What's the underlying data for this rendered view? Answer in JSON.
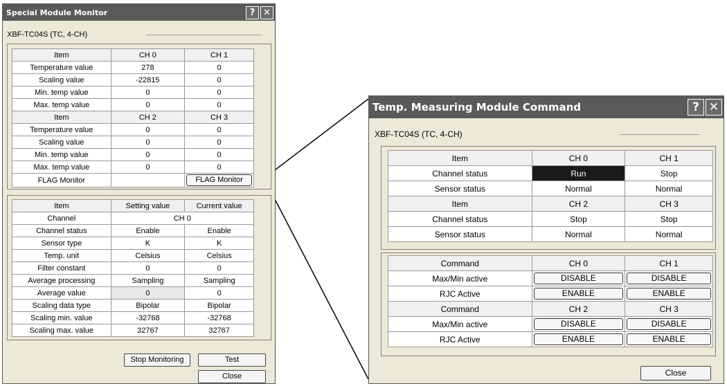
{
  "monitor": {
    "title": "Special Module Monitor",
    "help_glyph": "?",
    "close_glyph": "✕",
    "module": "XBF-TC04S (TC, 4-CH)",
    "table1": {
      "rows": [
        [
          "Item",
          "CH 0",
          "CH 1"
        ],
        [
          "Temperature value",
          "278",
          "0"
        ],
        [
          "Scaling value",
          "-22815",
          "0"
        ],
        [
          "Min. temp value",
          "0",
          "0"
        ],
        [
          "Max. temp value",
          "0",
          "0"
        ],
        [
          "Item",
          "CH 2",
          "CH 3"
        ],
        [
          "Temperature value",
          "0",
          "0"
        ],
        [
          "Scaling value",
          "0",
          "0"
        ],
        [
          "Min. temp value",
          "0",
          "0"
        ],
        [
          "Max. temp value",
          "0",
          "0"
        ]
      ],
      "flag_label": "FLAG Monitor",
      "flag_button": "FLAG Monitor"
    },
    "table2": {
      "header": [
        "Item",
        "Setting value",
        "Current value"
      ],
      "channel_label": "Channel",
      "channel_value": "CH 0",
      "rows": [
        [
          "Channel status",
          "Enable",
          "Enable"
        ],
        [
          "Sensor type",
          "K",
          "K"
        ],
        [
          "Temp. unit",
          "Celsius",
          "Celsius"
        ],
        [
          "Filter constant",
          "0",
          "0"
        ],
        [
          "Average processing",
          "Sampling",
          "Sampling"
        ],
        [
          "Average value",
          "0",
          "0"
        ],
        [
          "Scaling data type",
          "Bipolar",
          "Bipolar"
        ],
        [
          "Scaling min. value",
          "-32768",
          "-32768"
        ],
        [
          "Scaling max. value",
          "32767",
          "32767"
        ]
      ]
    },
    "buttons": {
      "stop": "Stop Monitoring",
      "test": "Test",
      "close": "Close"
    }
  },
  "command": {
    "title": "Temp. Measuring Module Command",
    "help_glyph": "?",
    "close_glyph": "✕",
    "module": "XBF-TC04S (TC, 4-CH)",
    "table1": {
      "rows": [
        [
          "Item",
          "CH 0",
          "CH 1"
        ],
        [
          "Channel status",
          "Run",
          "Stop"
        ],
        [
          "Sensor status",
          "Normal",
          "Normal"
        ],
        [
          "Item",
          "CH 2",
          "CH 3"
        ],
        [
          "Channel status",
          "Stop",
          "Stop"
        ],
        [
          "Sensor status",
          "Normal",
          "Normal"
        ]
      ]
    },
    "table2": {
      "rows": [
        [
          "Command",
          "CH 0",
          "CH 1"
        ],
        [
          "Max/Min active",
          "DISABLE",
          "DISABLE"
        ],
        [
          "RJC Active",
          "ENABLE",
          "ENABLE"
        ],
        [
          "Command",
          "CH 2",
          "CH 3"
        ],
        [
          "Max/Min active",
          "DISABLE",
          "DISABLE"
        ],
        [
          "RJC Active",
          "ENABLE",
          "ENABLE"
        ]
      ]
    },
    "buttons": {
      "close": "Close"
    }
  },
  "colors": {
    "titlebar": "#5a5a5a",
    "window": "#ece9d8",
    "active_cell": "#1a1a1a"
  }
}
